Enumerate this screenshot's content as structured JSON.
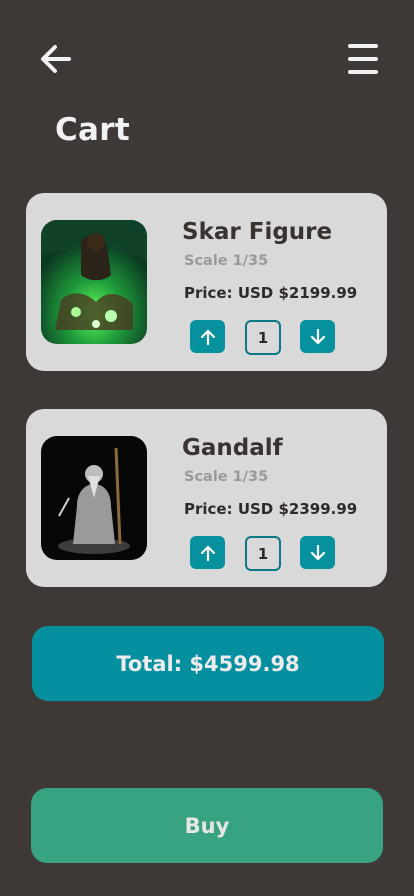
{
  "header": {
    "title": "Cart",
    "back_icon": "arrow-left-icon",
    "menu_icon": "hamburger-menu-icon"
  },
  "cart": {
    "items": [
      {
        "name": "Skar Figure",
        "scale": "Scale 1/35",
        "price": "Price: USD $2199.99",
        "quantity": "1",
        "image": "skar-figure-image"
      },
      {
        "name": "Gandalf",
        "scale": "Scale 1/35",
        "price": "Price: USD $2399.99",
        "quantity": "1",
        "image": "gandalf-figure-image"
      }
    ]
  },
  "summary": {
    "total": "Total: $4599.98"
  },
  "actions": {
    "buy_label": "Buy"
  },
  "colors": {
    "background": "#3e3836",
    "card": "#d9d9d9",
    "accent_teal": "#07919f",
    "buy_green": "#38a382"
  }
}
